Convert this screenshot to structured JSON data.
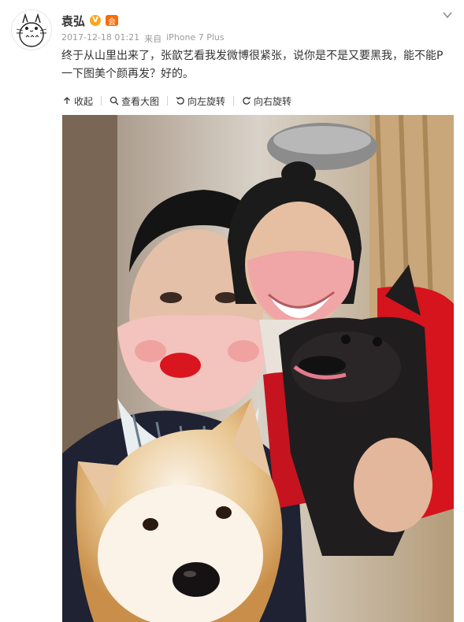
{
  "post": {
    "username": "袁弘",
    "verified_badge": "V",
    "member_badge": "会",
    "timestamp": "2017-12-18 01:21",
    "device_prefix": "来自",
    "device": "iPhone 7 Plus",
    "text": "终于从山里出来了，张歆艺看我发微博很紧张，说你是不是又要黑我，能不能P一下图美个颜再发？好的。"
  },
  "toolbar": {
    "collapse_label": "收起",
    "view_large_label": "查看大图",
    "rotate_left_label": "向左旋转",
    "rotate_right_label": "向右旋转"
  },
  "icons": {
    "collapse": "arrow-up-icon",
    "view_large": "magnifier-icon",
    "rotate_left": "rotate-left-icon",
    "rotate_right": "rotate-right-icon",
    "menu": "chevron-down-icon"
  },
  "colors": {
    "verified": "#f7a722",
    "member": "#ff6a00",
    "meta_text": "#9a9a9a",
    "toolbar_bg": "#ffffff"
  }
}
